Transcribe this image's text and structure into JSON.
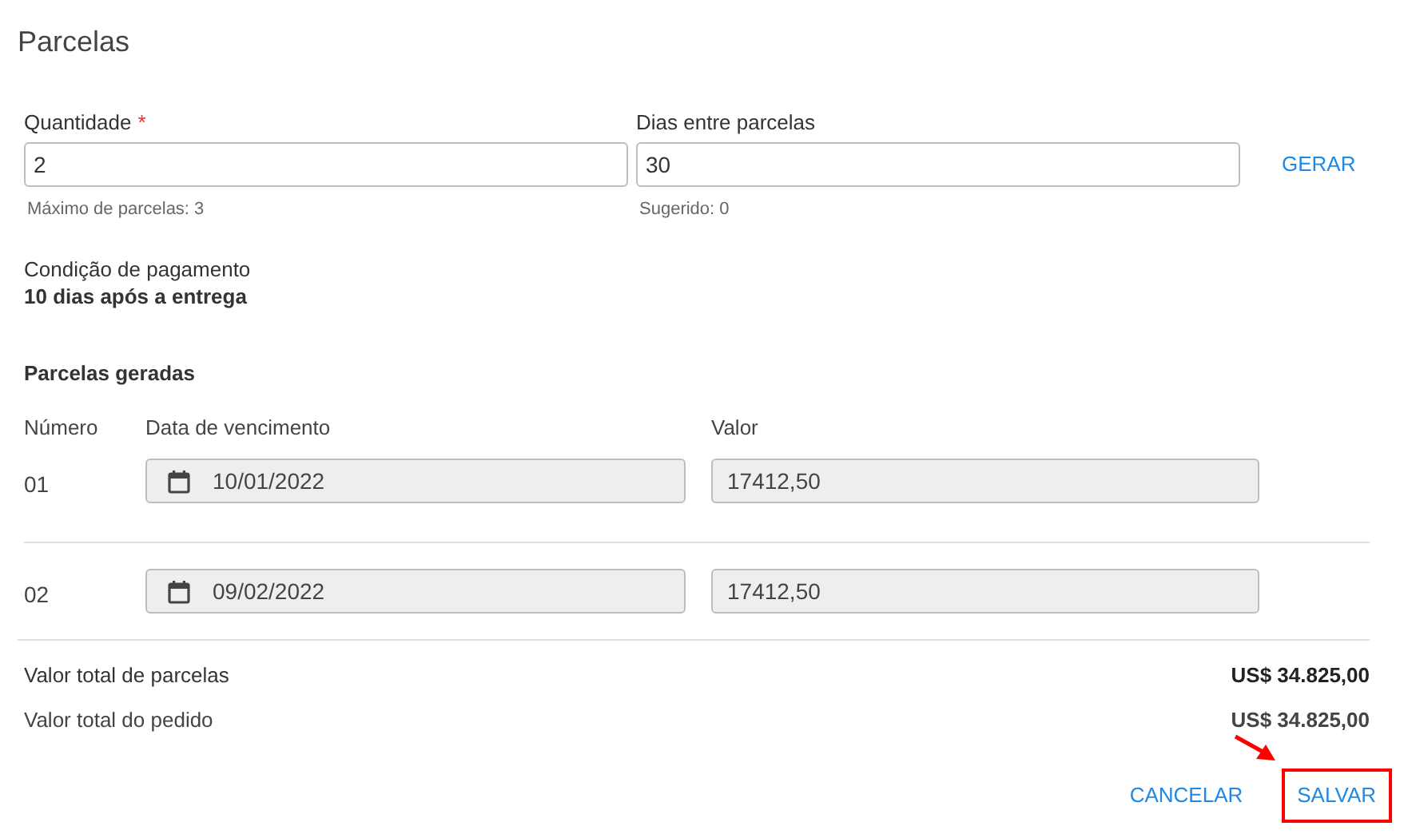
{
  "title": "Parcelas",
  "fields": [
    {
      "label": "Quantidade",
      "required_mark": "*",
      "value": "2",
      "hint": "Máximo de parcelas: 3"
    },
    {
      "label": "Dias entre parcelas",
      "value": "30",
      "hint": "Sugerido: 0"
    }
  ],
  "generate_button": "GERAR",
  "payment_condition": {
    "label": "Condição de pagamento",
    "value": "10 dias após a entrega"
  },
  "installments": {
    "title": "Parcelas geradas",
    "columns": [
      "Número",
      "Data de vencimento",
      "Valor"
    ],
    "rows": [
      {
        "number": "01",
        "due_date": "10/01/2022",
        "value": "17412,50"
      },
      {
        "number": "02",
        "due_date": "09/02/2022",
        "value": "17412,50"
      }
    ]
  },
  "totals": [
    {
      "label": "Valor total de parcelas",
      "value": "US$ 34.825,00"
    },
    {
      "label": "Valor total do pedido",
      "value": "US$ 34.825,00"
    }
  ],
  "actions": [
    {
      "label": "CANCELAR",
      "highlighted": false
    },
    {
      "label": "SALVAR",
      "highlighted": true
    }
  ]
}
